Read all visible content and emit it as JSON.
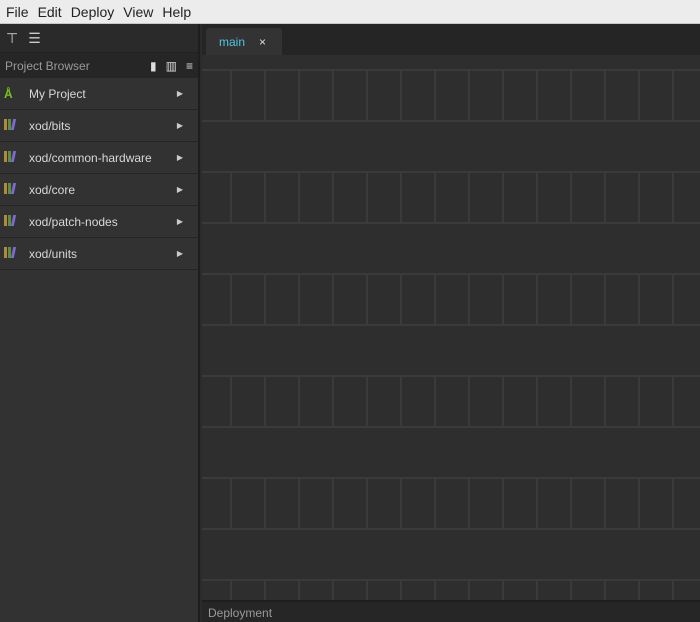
{
  "menu": [
    "File",
    "Edit",
    "Deploy",
    "View",
    "Help"
  ],
  "sidebar": {
    "title": "Project Browser",
    "items": [
      {
        "label": "My Project",
        "icon": "project-icon"
      },
      {
        "label": "xod/bits",
        "icon": "library-icon"
      },
      {
        "label": "xod/common-hardware",
        "icon": "library-icon"
      },
      {
        "label": "xod/core",
        "icon": "library-icon"
      },
      {
        "label": "xod/patch-nodes",
        "icon": "library-icon"
      },
      {
        "label": "xod/units",
        "icon": "library-icon"
      }
    ]
  },
  "tabs": [
    {
      "label": "main",
      "close": "×"
    }
  ],
  "footer": {
    "label": "Deployment"
  },
  "colors": {
    "accent": "#4fc3e0",
    "project": "#7cc31c"
  }
}
